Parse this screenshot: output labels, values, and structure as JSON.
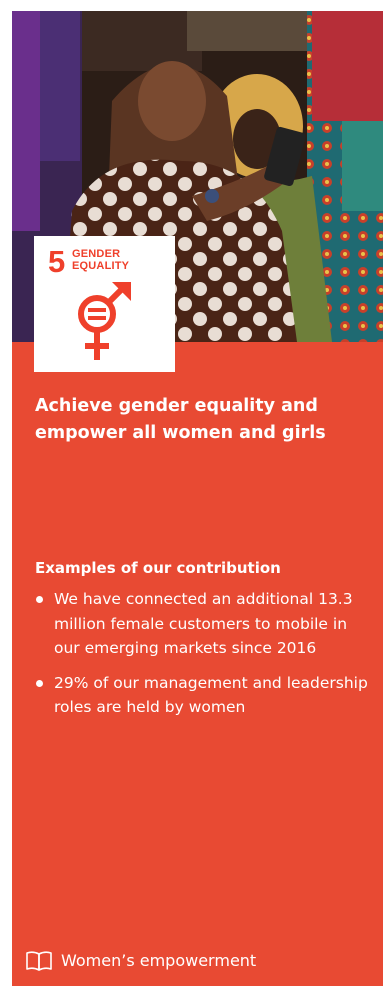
{
  "sdg": {
    "number": "5",
    "title_line1": "GENDER",
    "title_line2": "EQUALITY",
    "icon": "gender-equality-icon"
  },
  "photo": {
    "icon": "photo-two-women-looking-at-phone"
  },
  "goal": {
    "title": "Achieve gender equality and empower all women and girls"
  },
  "contribution": {
    "heading": "Examples of our contribution",
    "items": [
      "We have connected an additional 13.3 million female customers to mobile in our emerging markets since 2016",
      "29% of our management and leadership roles are held by women"
    ]
  },
  "footer": {
    "icon": "book-icon",
    "link_label": "Women’s empowerment"
  },
  "colors": {
    "card_background": "#e84a33",
    "sdg_red": "#ef402b",
    "text": "#ffffff"
  }
}
